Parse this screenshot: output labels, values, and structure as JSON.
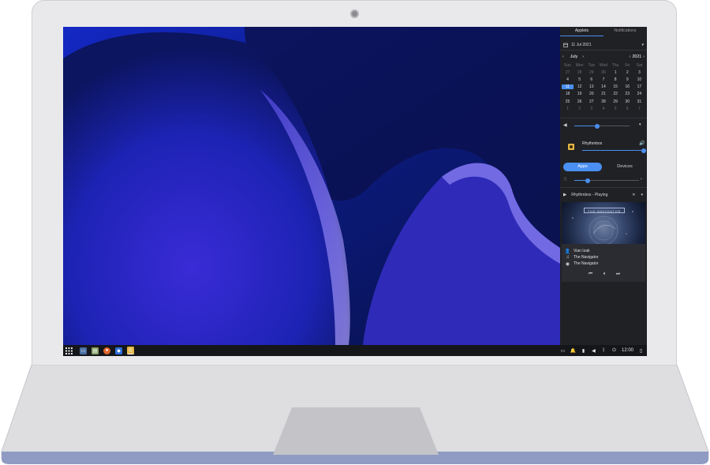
{
  "panel": {
    "tabs": [
      "Applets",
      "Notifications"
    ],
    "date": "11 Jul 2021",
    "month": "July",
    "year": "2021",
    "weekdays": [
      "Sun",
      "Mon",
      "Tue",
      "Wed",
      "Thu",
      "Fri",
      "Sat"
    ],
    "weeks": [
      [
        "27",
        "28",
        "29",
        "30",
        "1",
        "2",
        "3"
      ],
      [
        "4",
        "5",
        "6",
        "7",
        "8",
        "9",
        "10"
      ],
      [
        "11",
        "12",
        "13",
        "14",
        "15",
        "16",
        "17"
      ],
      [
        "18",
        "19",
        "20",
        "21",
        "22",
        "23",
        "24"
      ],
      [
        "25",
        "26",
        "27",
        "28",
        "29",
        "30",
        "31"
      ],
      [
        "1",
        "2",
        "3",
        "4",
        "5",
        "6",
        "7"
      ]
    ],
    "sound": {
      "master_volume": 0.41,
      "app_name": "Rhythmbox",
      "app_volume": 1.0,
      "btn_apps": "Apps",
      "btn_devices": "Devices",
      "mic_volume": 0.21
    },
    "player": {
      "header": "Rhythmbox - Playing",
      "album_art_text": "THE NAVIGATOR",
      "artist": "Vian Izak",
      "title": "The Navigator",
      "album": "The Navigator"
    }
  },
  "taskbar": {
    "clock": "12:00",
    "accent": "#4a8ff1"
  }
}
